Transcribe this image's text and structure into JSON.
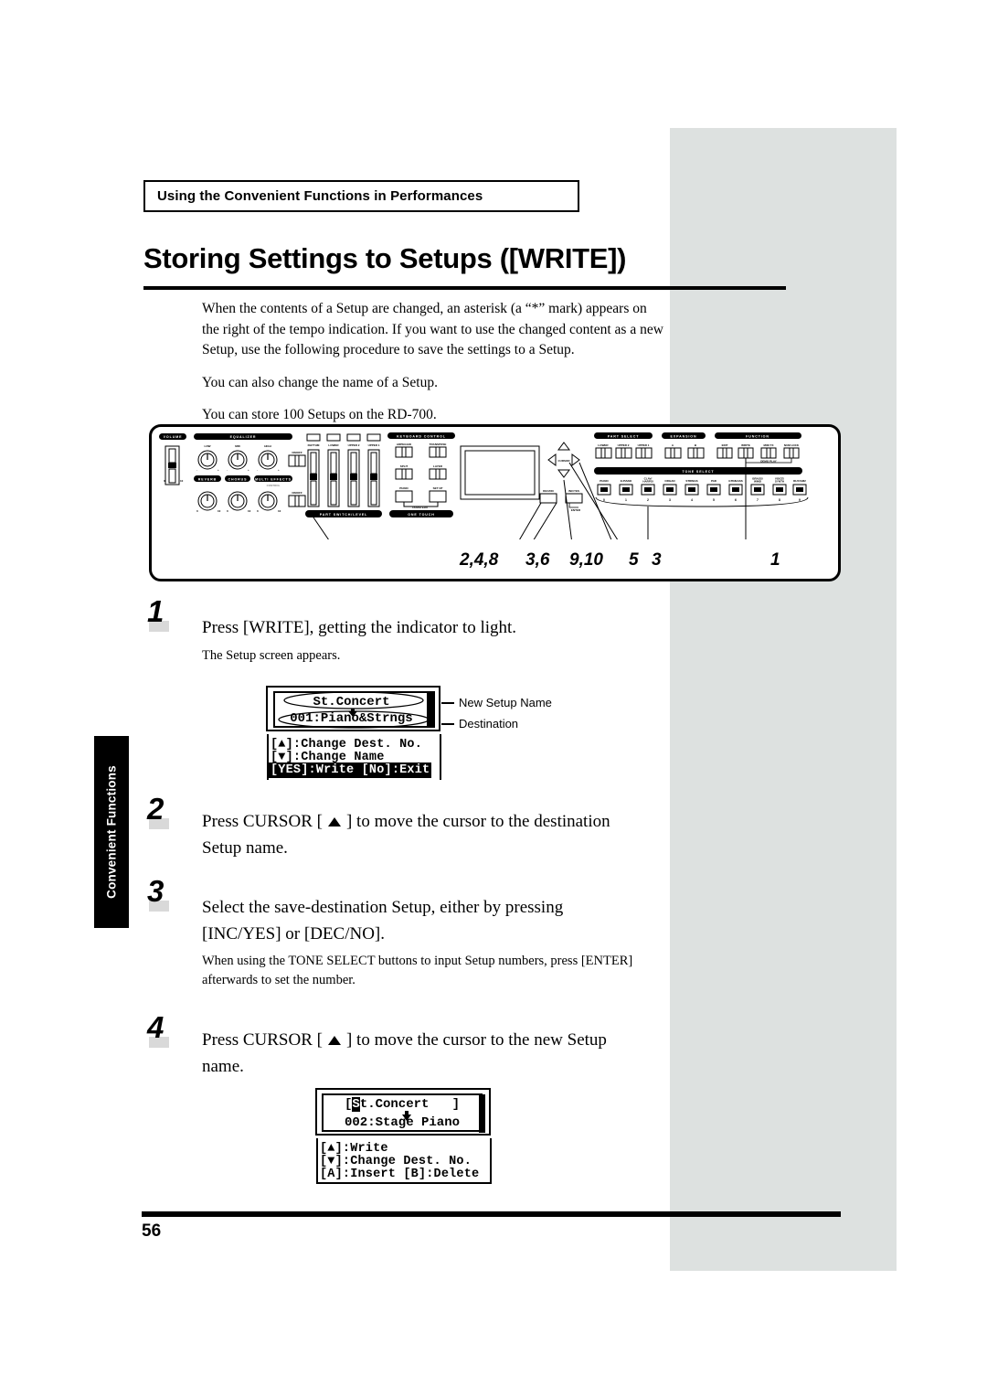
{
  "document": {
    "chapter_tab": "Convenient Functions",
    "chapter_heading": "Using the Convenient Functions in Performances",
    "title": "Storing Settings to Setups ([WRITE])",
    "page_number": "56"
  },
  "intro": {
    "p1": "When the contents of a Setup are changed, an asterisk (a “*” mark) appears on the right of the tempo indication. If you want to use the changed content as a new Setup, use the following procedure to save the settings to a Setup.",
    "p2": "You can also change the name of a Setup.",
    "p3": "You can store 100 Setups on the RD-700."
  },
  "panel": {
    "sections": {
      "volume": "VOLUME",
      "equalizer": "EQUALIZER",
      "eq_knobs": [
        "LOW",
        "MID",
        "HIGH"
      ],
      "on_off": "ON/OFF",
      "reverb": "REVERB",
      "chorus": "CHORUS",
      "multi_effects": "MULTI EFFECTS",
      "control": "CONTROL",
      "part_switch_level": "PART SWITCH/LEVEL",
      "part_sliders": [
        "RHYTHM",
        "LOWER",
        "UPPER 2",
        "UPPER 1"
      ],
      "keyboard_control": "KEYBOARD CONTROL",
      "keyboard_buttons": [
        "ARPEGGIO",
        "TRANSPOSE",
        "SPLIT",
        "LAYER",
        "PIANO",
        "SET UP"
      ],
      "piano_edit": "PIANO EDIT",
      "one_touch": "ONE TOUCH",
      "cursor": "CURSOR",
      "dec_no": "DEC/NO",
      "inc_yes": "INC/YES",
      "enter": "ENTER",
      "part_select": "PART SELECT",
      "part_select_buttons": [
        "LOWER",
        "UPPER 2",
        "UPPER 1"
      ],
      "expansion": "EXPANSION",
      "expansion_buttons": [
        "A",
        "B"
      ],
      "function": "FUNCTION",
      "function_buttons": [
        "EDIT",
        "WRITE",
        "MIDI TX",
        "NUM LOCK"
      ],
      "demo_play": "DEMO PLAY",
      "tone_select": "TONE SELECT",
      "tone_buttons": [
        "PIANO",
        "E.PIANO",
        "CLAV/HARPSI",
        "ORGAN",
        "STRINGS",
        "PAD",
        "GTR/BASS",
        "BRASS/WIND",
        "VOICE/SYNTH",
        "RHY/GM2"
      ],
      "tone_numbers": [
        "0",
        "1",
        "2",
        "3",
        "4",
        "5",
        "6",
        "7",
        "8",
        "9"
      ]
    },
    "callouts": [
      {
        "label": "2,4,8"
      },
      {
        "label": "3,6"
      },
      {
        "label": "9,10"
      },
      {
        "label": "5"
      },
      {
        "label": "3"
      },
      {
        "label": "1"
      }
    ]
  },
  "steps": [
    {
      "number": "1",
      "main": "Press [WRITE], getting the indicator to light.",
      "sub": "The Setup screen appears."
    },
    {
      "number": "2",
      "main_before": "Press CURSOR [",
      "main_after": "] to move the cursor to the destination Setup name.",
      "sub": ""
    },
    {
      "number": "3",
      "main": "Select the save-destination Setup, either by pressing [INC/YES] or [DEC/NO].",
      "sub": "When using the TONE SELECT buttons to input Setup numbers, press [ENTER] afterwards to set the number."
    },
    {
      "number": "4",
      "main_before": "Press CURSOR [",
      "main_after": "] to move the cursor to the new Setup name.",
      "sub": ""
    }
  ],
  "lcd1": {
    "name_line": "St.Concert",
    "dest_line": "001:Piano&Strngs",
    "line3": "[▲]:Change Dest. No.",
    "line4": "[▼]:Change Name",
    "line5": "[YES]:Write [No]:Exit",
    "annotation_name": "New Setup Name",
    "annotation_dest": "Destination"
  },
  "lcd2": {
    "name_line_prefix": "[",
    "name_cursor": "S",
    "name_line_rest": "t.Concert   ]",
    "dest_line": "002:Stage Piano",
    "line3": "[▲]:Write",
    "line4": "[▼]:Change Dest. No.",
    "line5": "[A]:Insert [B]:Delete"
  }
}
